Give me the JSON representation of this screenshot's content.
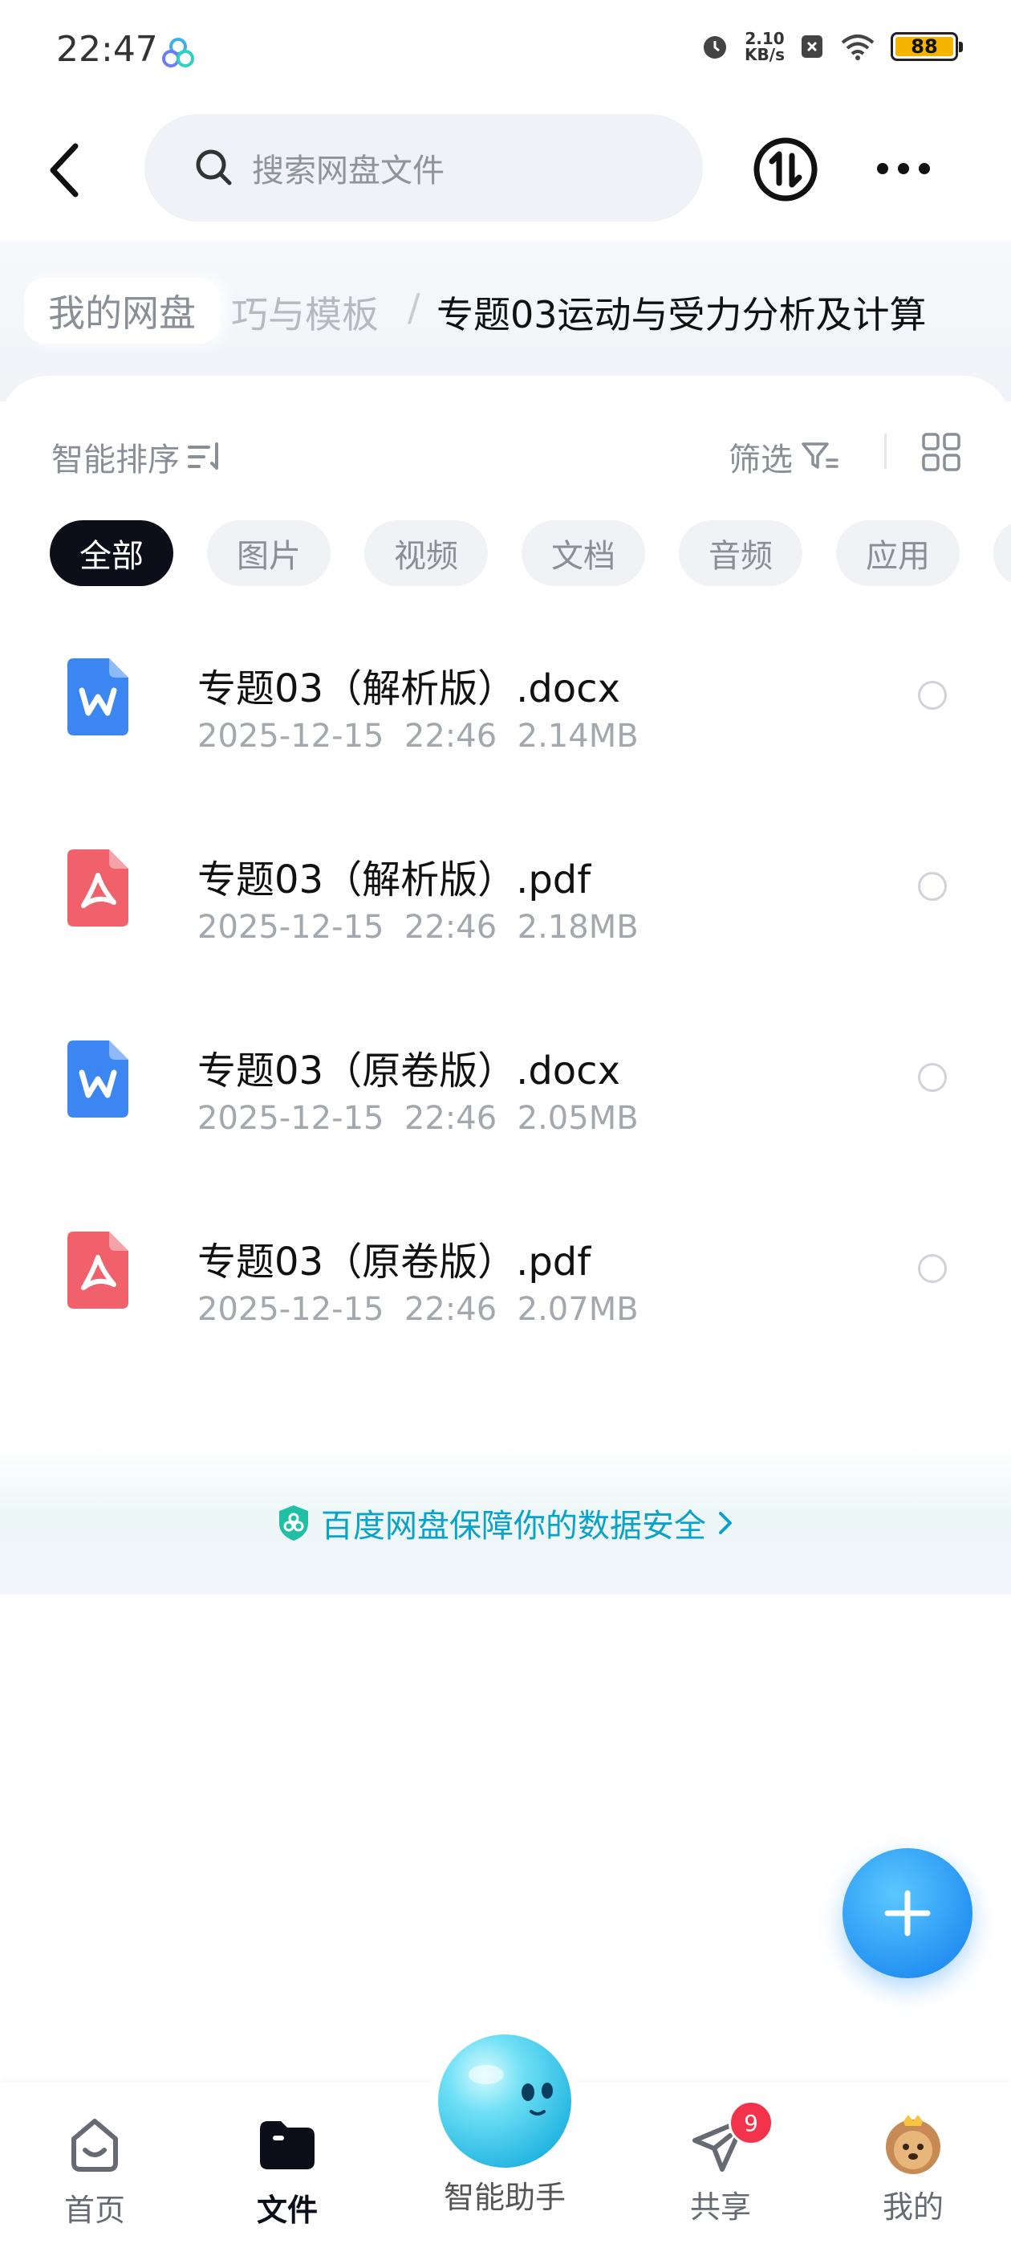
{
  "status_bar": {
    "time": "22:47",
    "net_speed_value": "2.10",
    "net_speed_unit": "KB/s",
    "battery": "88"
  },
  "header": {
    "search_placeholder": "搜索网盘文件"
  },
  "breadcrumb": {
    "root": "我的网盘",
    "middle": "巧与模板",
    "separator": "/",
    "current": "专题03运动与受力分析及计算"
  },
  "toolbar": {
    "sort_label": "智能排序",
    "filter_label": "筛选"
  },
  "chips": [
    "全部",
    "图片",
    "视频",
    "文档",
    "音频",
    "应用"
  ],
  "files": [
    {
      "name": "专题03（解析版）.docx",
      "date": "2025-12-15",
      "time": "22:46",
      "size": "2.14MB",
      "type": "word-icon"
    },
    {
      "name": "专题03（解析版）.pdf",
      "date": "2025-12-15",
      "time": "22:46",
      "size": "2.18MB",
      "type": "pdf-icon"
    },
    {
      "name": "专题03（原卷版）.docx",
      "date": "2025-12-15",
      "time": "22:46",
      "size": "2.05MB",
      "type": "word-icon"
    },
    {
      "name": "专题03（原卷版）.pdf",
      "date": "2025-12-15",
      "time": "22:46",
      "size": "2.07MB",
      "type": "pdf-icon"
    }
  ],
  "security_banner": "百度网盘保障你的数据安全",
  "bottom_nav": {
    "home": "首页",
    "files": "文件",
    "assistant": "智能助手",
    "share": "共享",
    "share_badge": "9",
    "me": "我的"
  },
  "colors": {
    "accent": "#1f8cf0",
    "word": "#3b86f0",
    "pdf": "#f0616b",
    "security_text": "#0aa2c8",
    "badge": "#f2334b"
  }
}
